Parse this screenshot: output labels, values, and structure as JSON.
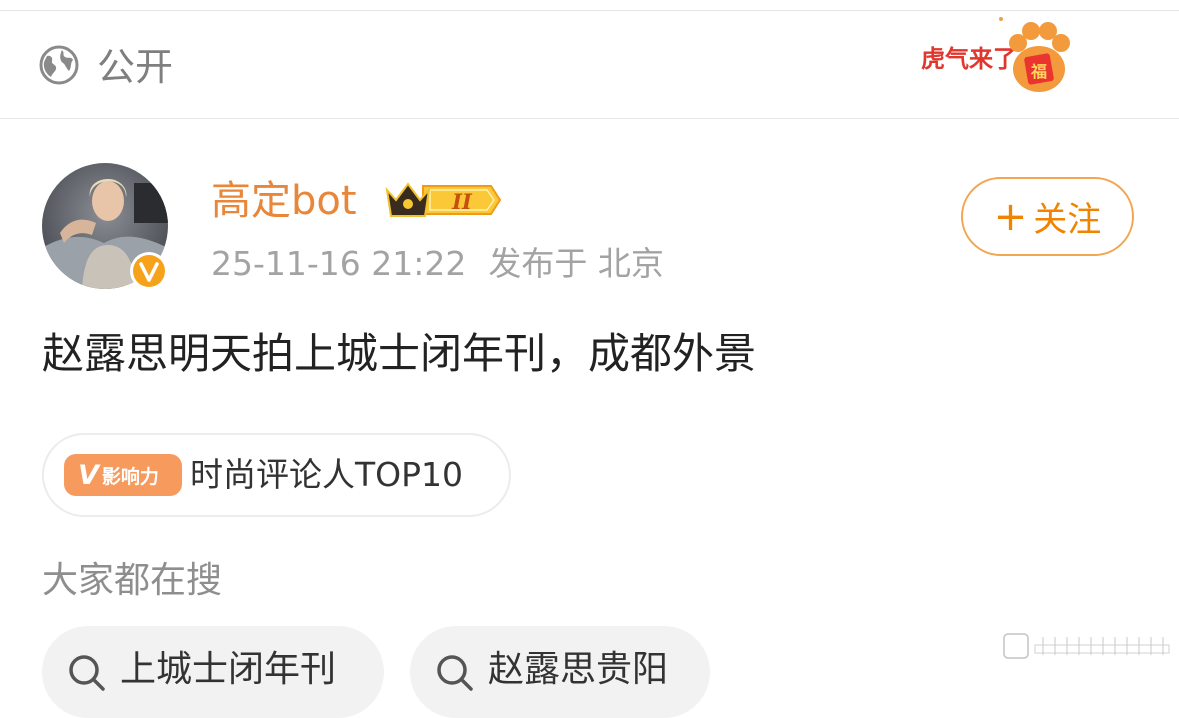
{
  "visibility": {
    "label": "公开",
    "icon": "globe-icon"
  },
  "decoration": {
    "icon": "tiger-paw-fortune-sticker",
    "text": "虎气来了",
    "seal": "福"
  },
  "post": {
    "author": {
      "name": "高定bot",
      "avatar": "avatar-photo",
      "verified_icon": "verified-v-icon",
      "vip_icon": "crown-ii-icon",
      "vip_level": "II"
    },
    "timestamp": "25-11-16 21:22",
    "location": "发布于 北京",
    "follow_label": "关注",
    "text": "赵露思明天拍上城士闭年刊，成都外景"
  },
  "influence": {
    "badge_v": "V",
    "badge_text": "影响力",
    "label": "时尚评论人TOP10"
  },
  "trending": {
    "title": "大家都在搜",
    "items": [
      "上城士闭年刊",
      "赵露思贵阳"
    ]
  },
  "colors": {
    "accent": "#f08300",
    "username": "#e8863a",
    "muted": "#a3a3a3",
    "badge_orange": "#f79a5e"
  }
}
